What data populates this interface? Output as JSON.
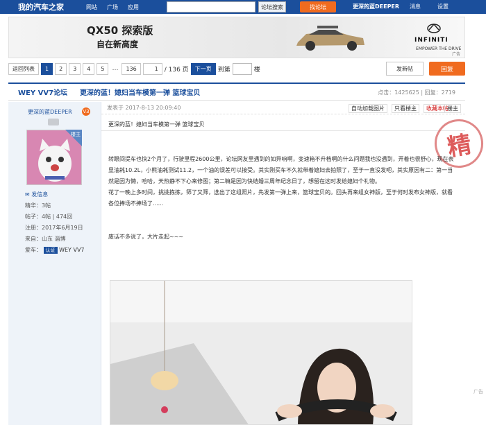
{
  "topbar": {
    "logo": "我的汽车之家",
    "nav": [
      "网站",
      "广场",
      "应用"
    ],
    "search_button": "论坛搜索",
    "forum_button": "找论坛",
    "user": "更深的蓝DEEPER",
    "messages": "消息",
    "settings": "设置"
  },
  "banner": {
    "model": "QX50 探索版",
    "slogan": "自在新高度",
    "brand": "INFINITI",
    "tagline": "EMPOWER THE DRIVE",
    "ad_label": "广告"
  },
  "pager": {
    "back": "返回列表",
    "pages": [
      "1",
      "2",
      "3",
      "4",
      "5"
    ],
    "last": "136",
    "current_value": "1",
    "total": "/ 136 页",
    "next": "下一页",
    "goto_prefix": "到第",
    "goto_suffix": "楼",
    "new_post": "发新帖",
    "reply": "回复"
  },
  "thread": {
    "forum": "WEY VV7论坛",
    "title": "更深的蓝！媳妇当车模第一弹 篮球宝贝",
    "stats": "点击：1425625 | 回复：2719"
  },
  "author": {
    "name": "更深的蓝DEEPER",
    "level": "V3",
    "badge": "楼主",
    "send_msg": "发信息",
    "essence": "精华：3帖",
    "posts": "帖子：4帖 | 474回",
    "registered": "注册：2017年6月19日",
    "from": "来自：山东 淄博",
    "car_label": "爱车：",
    "auth": "认证",
    "car": "WEY VV7"
  },
  "post": {
    "time": "发表于 2017-8-13 20:09:40",
    "auto_load": "自动加载图片",
    "only_op": "只看楼主",
    "favorite": "收藏本帖",
    "floor": "楼主",
    "title": "更深的蓝！媳妇当车模第一弹 篮球宝贝",
    "stamp": "精",
    "para1": "转眼间提车也快2个月了，行驶里程2600公里，论坛网友里遇到的如异响啊，变速箱不升档啊的什么问题我也没遇到，开着也很舒心，现在表显油耗10.2L，小熊油耗测试11.2，一个油的误差可以接受。其实刚买车不久就带着媳妇去拍照了，至于一直没发吧，其实原因有二：第一当然是因为懒，哈哈，天热静不下心来修图；第二嘛是因为快结婚三周年纪念日了，想留在这时发给媳妇个礼物。",
    "para2": "花了一晚上多时间，挑挑拣拣，筛了又筛，选出了这组照片，先发第一弹上来，篮球宝贝的。回头再来组女神版，至于何时发布女神版，就看各位捧场不捧场了......",
    "para3": "废话不多说了，大片走起~~~"
  },
  "right_edge": "广告"
}
